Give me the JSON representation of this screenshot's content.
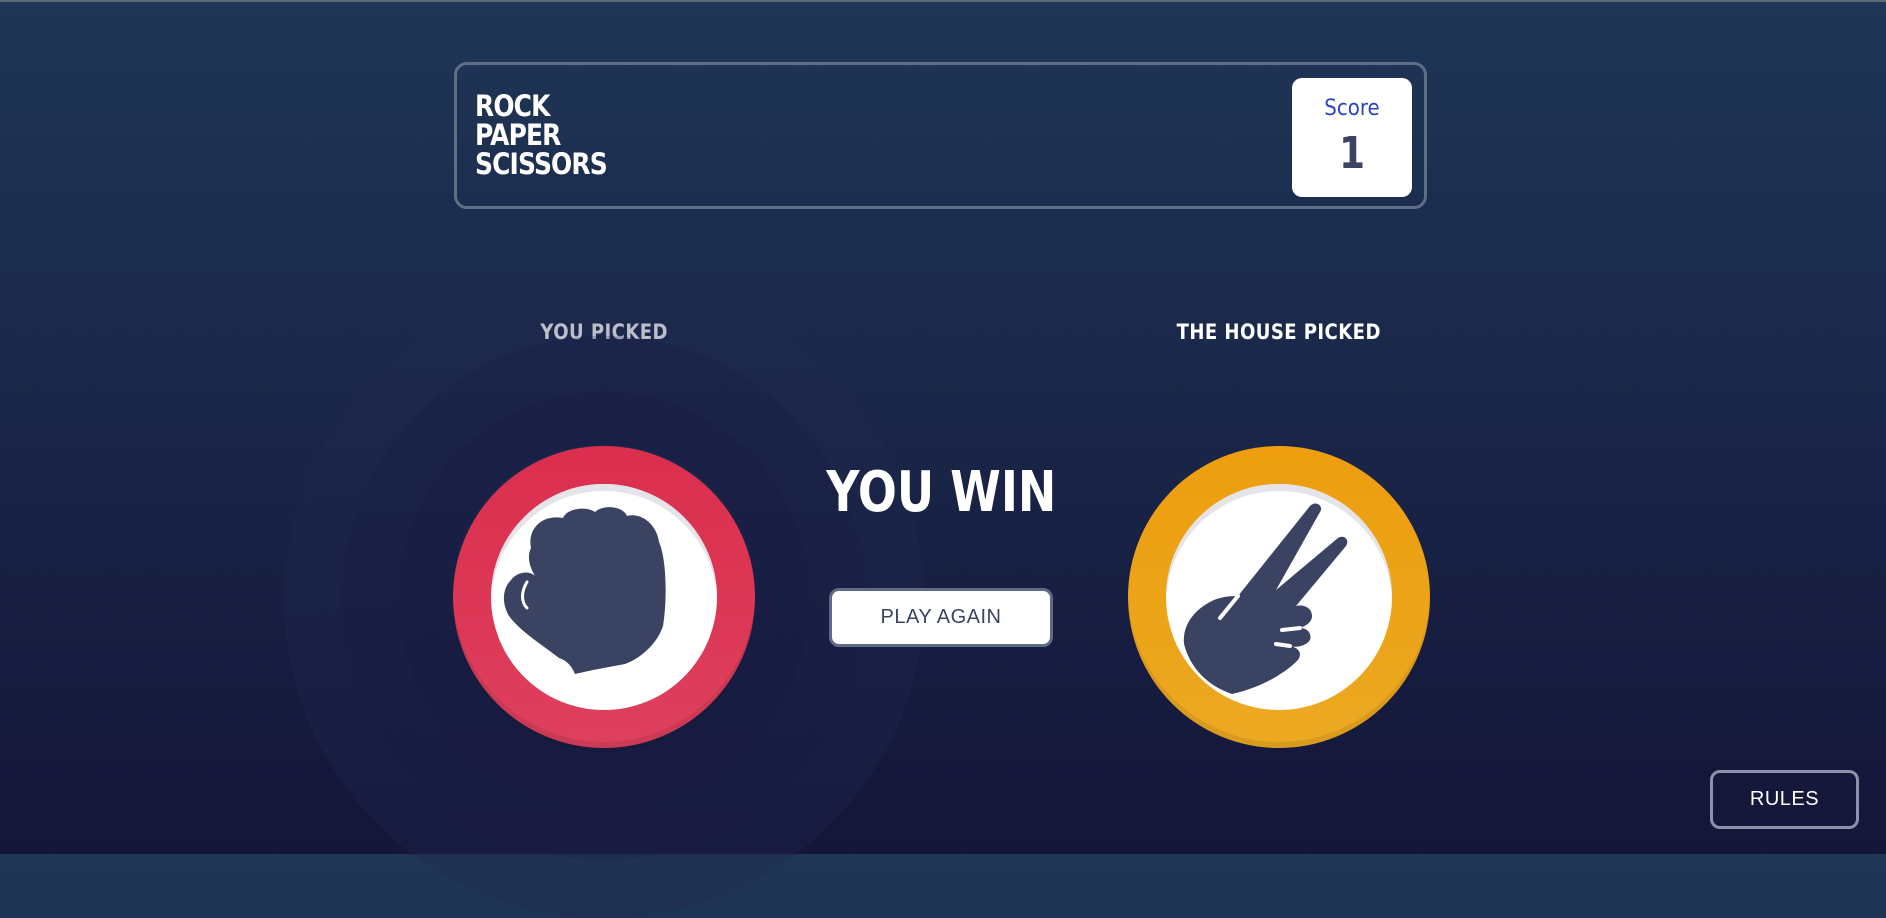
{
  "header": {
    "title_lines": [
      "ROCK",
      "PAPER",
      "SCISSORS"
    ],
    "score_label": "Score",
    "score_value": "1"
  },
  "game": {
    "player_label": "YOU PICKED",
    "house_label": "THE HOUSE PICKED",
    "player_pick": "rock",
    "house_pick": "scissors",
    "result": "YOU WIN",
    "play_again_label": "PLAY AGAIN"
  },
  "footer": {
    "rules_label": "RULES"
  },
  "icons": {
    "rock": "rock-hand-icon",
    "scissors": "scissors-hand-icon"
  },
  "colors": {
    "background_top": "#1f3656",
    "background_bottom": "#141539",
    "rock": "#dc2e4e",
    "scissors": "#ec9e0e",
    "score_label": "#2a45c2",
    "dark_text": "#3b4363"
  }
}
